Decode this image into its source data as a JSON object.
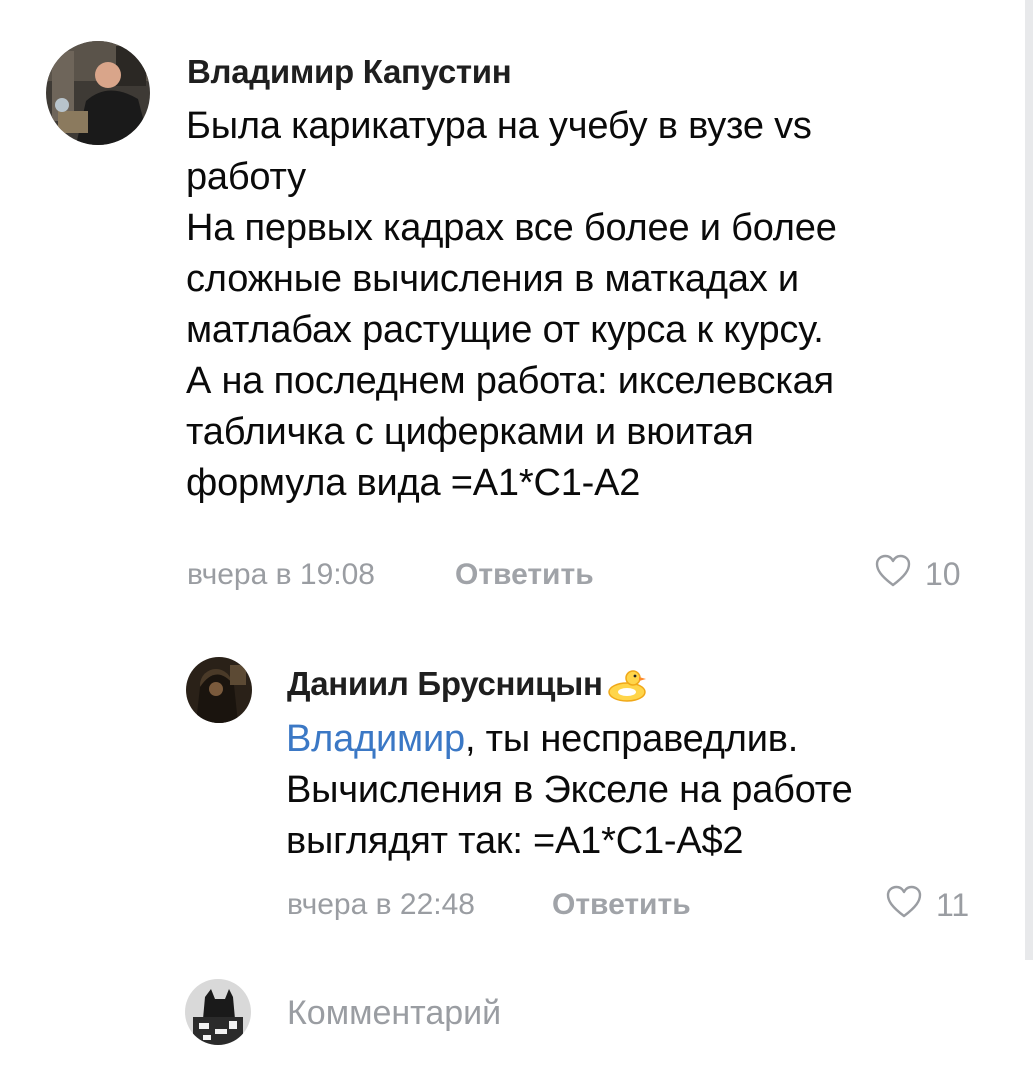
{
  "comments": [
    {
      "author": "Владимир Капустин",
      "lines": [
        "Была карикатура на учебу в вузе vs",
        "работу",
        "На первых кадрах все более и более",
        "сложные вычисления в маткадах и",
        "матлабах растущие от курса к курсу.",
        "А на последнем работа: икселевская",
        "табличка с циферками и вюитая",
        "формула вида =А1*С1-А2"
      ],
      "time": "вчера в 19:08",
      "reply_label": "Ответить",
      "likes": "10"
    }
  ],
  "reply": {
    "author": "Даниил Брусницын",
    "mention": "Владимир",
    "first_line_rest": ", ты несправедлив.",
    "lines": [
      "Вычисления в Экселе на работе",
      "выглядят так: =А1*С1-А$2"
    ],
    "time": "вчера в 22:48",
    "reply_label": "Ответить",
    "likes": "11"
  },
  "composer": {
    "placeholder": "Комментарий"
  },
  "colors": {
    "mention": "#3b78c5",
    "meta": "#9a9da2"
  },
  "icons": {
    "like": "heart-outline-icon",
    "author_badge": "rubber-duck-icon"
  }
}
